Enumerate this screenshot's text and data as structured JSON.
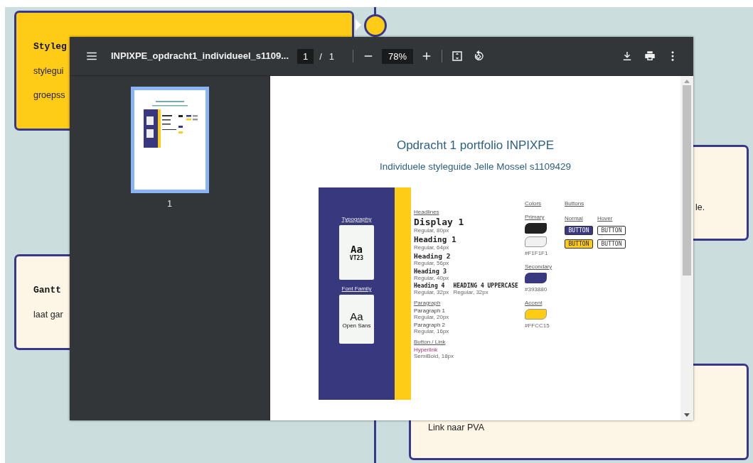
{
  "timeline": {
    "cards": [
      {
        "title": "Styleg",
        "lines": [
          "stylegui",
          "groepss"
        ]
      },
      {
        "lines": [
          "le."
        ]
      },
      {
        "title": "Gantt",
        "lines": [
          "laat gar"
        ]
      },
      {
        "lines": [
          "Link naar PVA"
        ]
      }
    ]
  },
  "pdf_viewer": {
    "file_name": "INPIXPE_opdracht1_individueel_s1109...",
    "page_current": "1",
    "page_separator": "/",
    "page_total": "1",
    "zoom": "78%",
    "thumbnails": [
      {
        "label": "1",
        "selected": true
      }
    ],
    "document": {
      "title": "Opdracht 1 portfolio INPIXPE",
      "subtitle": "Individuele styleguide Jelle Mossel s1109429",
      "fonts": [
        {
          "heading": "Typography",
          "sample": "Aa",
          "name": "VT23",
          "kind": "mono"
        },
        {
          "heading": "Font Family",
          "sample": "Aa",
          "name": "Open Sans",
          "kind": "sans"
        }
      ],
      "headlines": {
        "heading": "Headlines",
        "rows": [
          {
            "kind": "display",
            "items": [
              {
                "name": "Display 1",
                "spec": "Regular, 80px"
              }
            ]
          },
          {
            "kind": "h1",
            "items": [
              {
                "name": "Heading 1",
                "spec": "Regular, 64px"
              }
            ]
          },
          {
            "kind": "h2",
            "items": [
              {
                "name": "Heading 2",
                "spec": "Regular, 56px"
              }
            ]
          },
          {
            "kind": "h3",
            "items": [
              {
                "name": "Heading 3",
                "spec": "Regular, 40px"
              }
            ]
          },
          {
            "kind": "h4",
            "items": [
              {
                "name": "Heading 4",
                "spec": "Regular, 32px"
              },
              {
                "name": "HEADING 4 UPPERCASE",
                "spec": "Regular, 32px"
              }
            ]
          }
        ]
      },
      "paragraph": {
        "heading": "Paragraph",
        "items": [
          {
            "name": "Paragraph 1",
            "spec": "Regular, 20px"
          },
          {
            "name": "Paragraph 2",
            "spec": "Regular, 16px"
          }
        ]
      },
      "links": {
        "heading": "Button / Link",
        "items": [
          {
            "name": "Hyperlink",
            "spec": "SemiBold, 18px"
          }
        ]
      },
      "colors": {
        "heading": "Colors",
        "groups": [
          {
            "label": "Primary",
            "swatches": [
              {
                "color": "#222222"
              },
              {
                "color": "#f1f1f1",
                "code": "#F1F1F1"
              }
            ]
          },
          {
            "label": "Secondary",
            "swatches": [
              {
                "color": "#393880",
                "code": "#393880"
              }
            ]
          },
          {
            "label": "Accent",
            "swatches": [
              {
                "color": "#ffcc15",
                "code": "#FFCC15"
              }
            ]
          }
        ]
      },
      "buttons": {
        "heading": "Buttons",
        "columns": [
          "Normal",
          "Hover"
        ],
        "rows": [
          [
            {
              "label": "BUTTON",
              "kind": "filled",
              "color": "#393880"
            },
            {
              "label": "BUTTON",
              "kind": "outline"
            }
          ],
          [
            {
              "label": "BUTTON",
              "kind": "filled",
              "color": "#ffcc15"
            },
            {
              "label": "BUTTON",
              "kind": "outline"
            }
          ]
        ]
      }
    }
  }
}
